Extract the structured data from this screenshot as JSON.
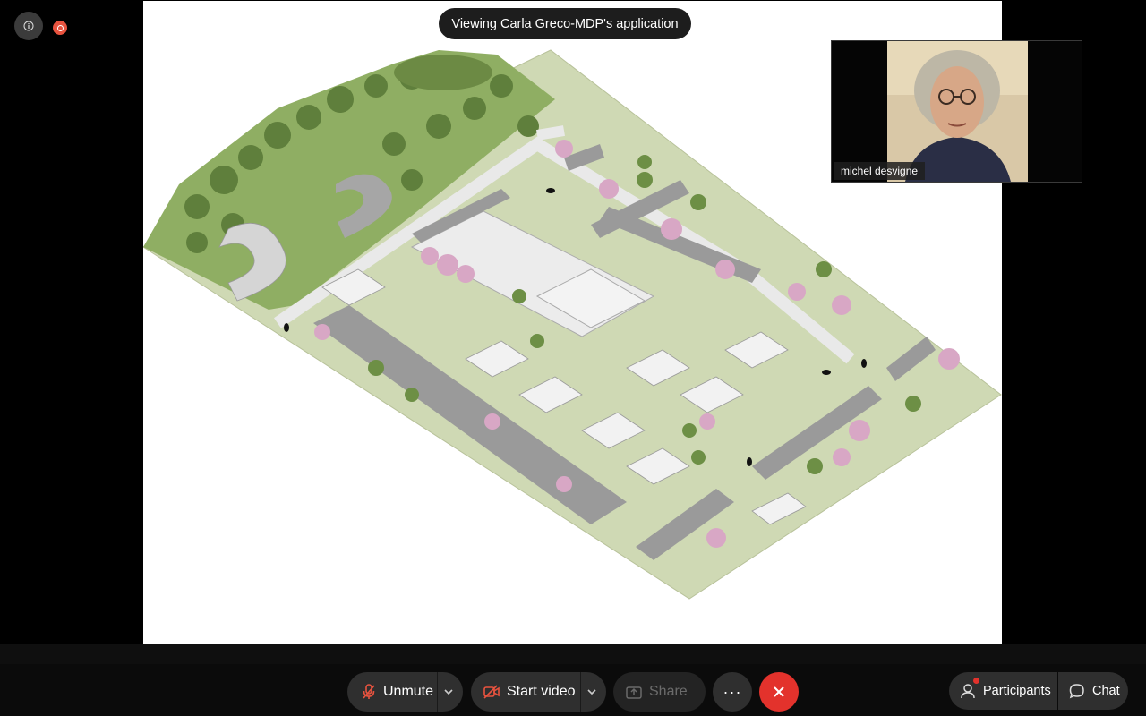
{
  "meeting": {
    "viewing_banner": "Viewing Carla Greco-MDP's application"
  },
  "video_tile": {
    "participant_name": "michel desvigne"
  },
  "toolbar": {
    "unmute_label": "Unmute",
    "start_video_label": "Start video",
    "share_label": "Share",
    "more_label": "···",
    "participants_label": "Participants",
    "chat_label": "Chat"
  },
  "colors": {
    "end_call": "#e3322c",
    "recording": "#e8533f",
    "mic_muted": "#e8533f",
    "toolbar_button": "#2f2f2f"
  },
  "icons": [
    "info-icon",
    "recording-icon",
    "mic-muted-icon",
    "video-off-icon",
    "share-icon",
    "more-icon",
    "close-icon",
    "participants-icon",
    "chat-icon",
    "chevron-down-icon"
  ]
}
